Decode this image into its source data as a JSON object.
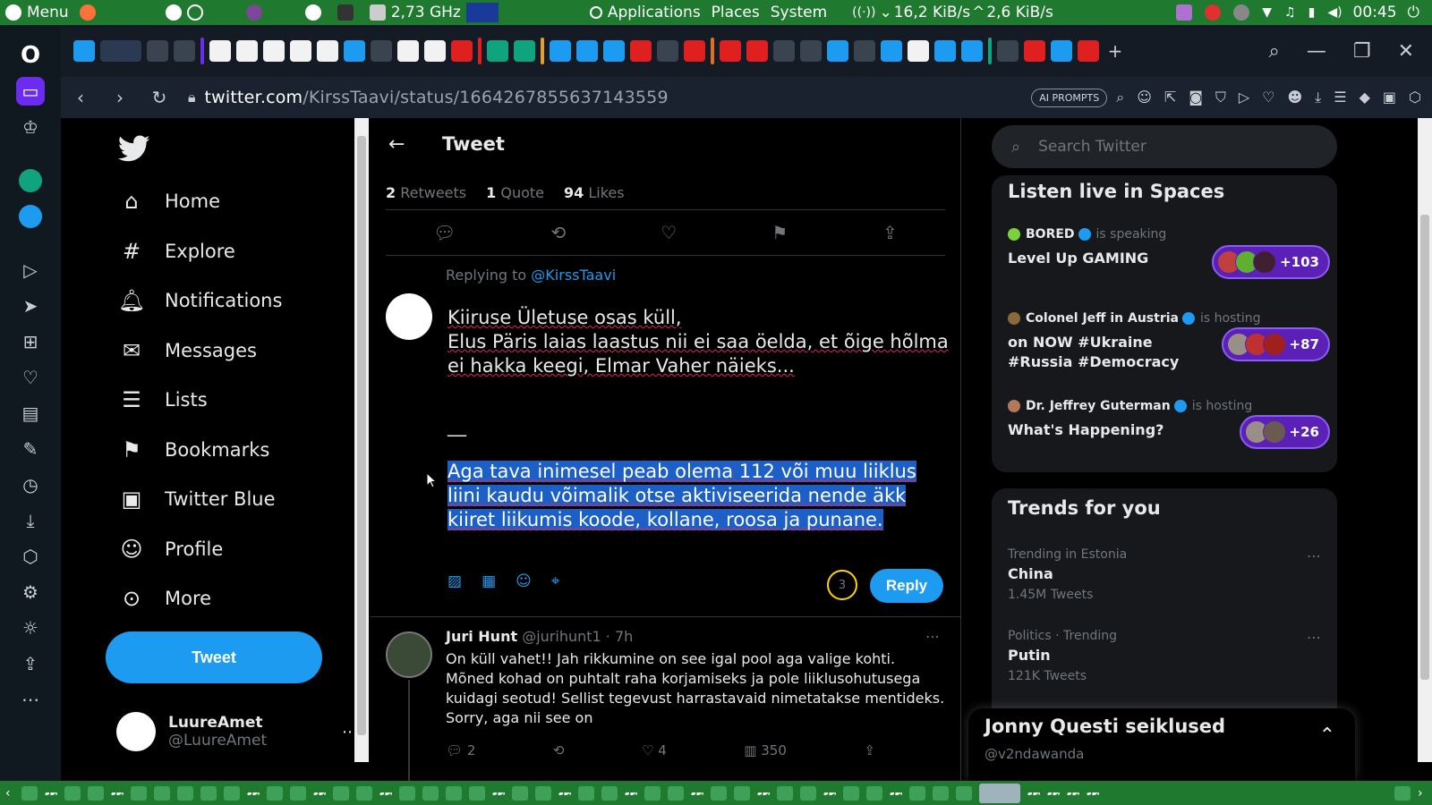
{
  "os_bar": {
    "menu_label": "Menu",
    "cpu": "2,73 GHz",
    "applications": "Applications",
    "places": "Places",
    "system": "System",
    "net": "16,2 KiB/s",
    "net_up": "2,6 KiB/s",
    "clock": "00:45"
  },
  "browser": {
    "url_host": "twitter.com",
    "url_path": "/KirssTaavi/status/1664267855637143559",
    "ai_prompts": "AI PROMPTS"
  },
  "nav": {
    "items": [
      {
        "label": "Home",
        "icon": "home-icon"
      },
      {
        "label": "Explore",
        "icon": "hash-icon"
      },
      {
        "label": "Notifications",
        "icon": "bell-icon"
      },
      {
        "label": "Messages",
        "icon": "mail-icon"
      },
      {
        "label": "Lists",
        "icon": "list-icon"
      },
      {
        "label": "Bookmarks",
        "icon": "bookmark-icon"
      },
      {
        "label": "Twitter Blue",
        "icon": "twitter-blue-icon"
      },
      {
        "label": "Profile",
        "icon": "person-icon"
      },
      {
        "label": "More",
        "icon": "more-circle-icon"
      }
    ],
    "tweet_button": "Tweet",
    "account": {
      "display_name": "LuureAmet",
      "handle": "@LuureAmet"
    }
  },
  "tweet": {
    "header_title": "Tweet",
    "stats": {
      "retweets_count": "2",
      "retweets_label": "Retweets",
      "quotes_count": "1",
      "quotes_label": "Quote",
      "likes_count": "94",
      "likes_label": "Likes"
    },
    "replying_to_prefix": "Replying to",
    "replying_to_handle": "@KirssTaavi",
    "composer_lines": [
      "Kiiruse Ületuse osas küll,",
      "Elus Päris laias laastus nii ei saa öelda, et õige hõlma ei hakka keegi, Elmar Vaher näieks..."
    ],
    "composer_separator": "__",
    "composer_selected": "Aga tava inimesel peab olema 112 või muu liiklus liini kaudu võimalik otse aktiviseerida nende äkk kiiret liikumis koode, kollane, roosa ja punane.",
    "char_counter": "3",
    "reply_button": "Reply"
  },
  "reply": {
    "display_name": "Juri Hunt",
    "handle": "@jurihunt1",
    "time": "· 7h",
    "text": "On küll vahet!! Jah rikkumine on see igal pool aga valige kohti. Mõned kohad on puhtalt raha korjamiseks ja pole liiklusohutusega kuidagi seotud! Sellist tegevust harrastavaid nimetatakse mentideks. Sorry, aga nii see on",
    "replies": "2",
    "likes": "4",
    "views": "350"
  },
  "right": {
    "search_placeholder": "Search Twitter",
    "spaces_title": "Listen live in Spaces",
    "spaces": [
      {
        "host": "BORED",
        "status": "is speaking",
        "title": "Level Up GAMING",
        "count": "+103"
      },
      {
        "host": "Colonel Jeff in Austria",
        "status": "is hosting",
        "title": "on NOW #Ukraine #Russia #Democracy",
        "count": "+87"
      },
      {
        "host": "Dr. Jeffrey Guterman",
        "status": "is hosting",
        "title": "What's Happening?",
        "count": "+26"
      }
    ],
    "trends_title": "Trends for you",
    "trends": [
      {
        "context": "Trending in Estonia",
        "name": "China",
        "count": "1.45M Tweets"
      },
      {
        "context": "Politics · Trending",
        "name": "Putin",
        "count": "121K Tweets"
      }
    ]
  },
  "drawer": {
    "title": "Jonny Questi seiklused",
    "subtitle": "@v2ndawanda"
  }
}
